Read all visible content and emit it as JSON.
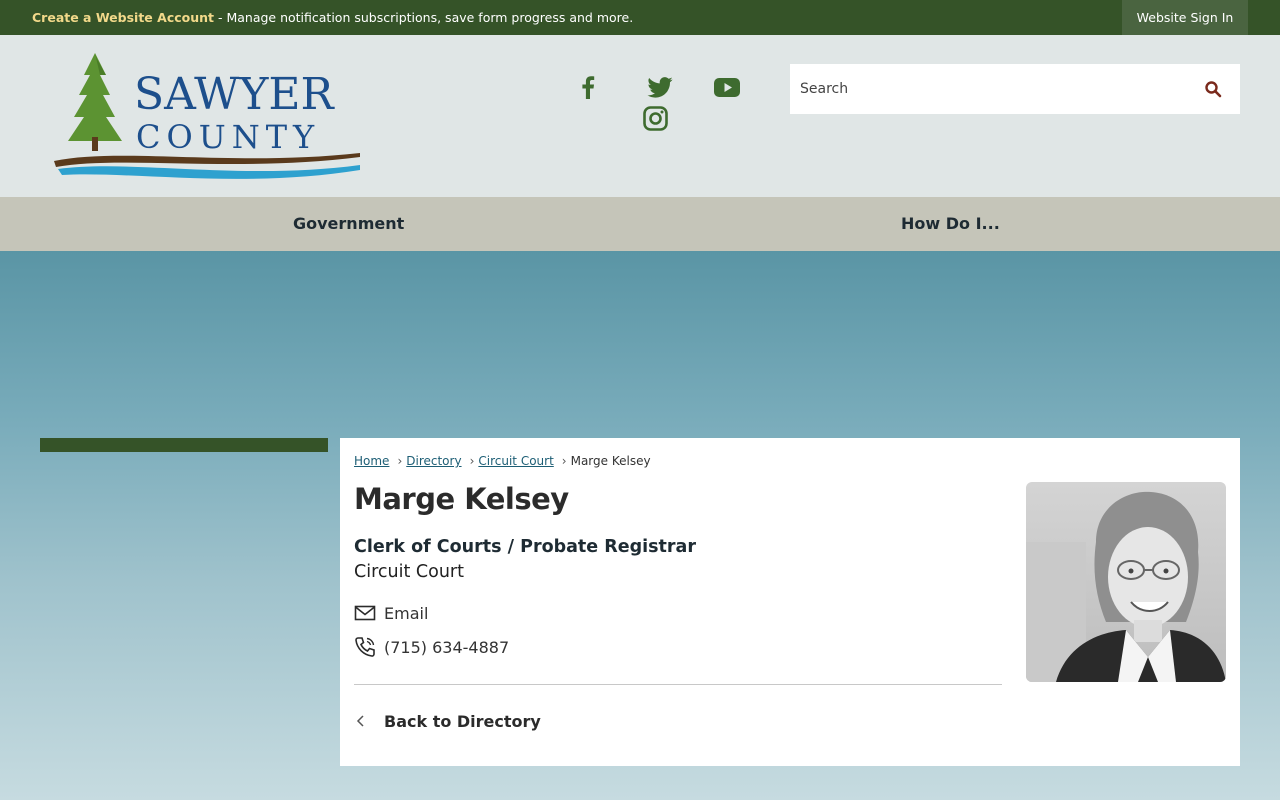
{
  "top_bar": {
    "create_account_link": "Create a Website Account",
    "message": " - Manage notification subscriptions, save form progress and more.",
    "sign_in_label": "Website Sign In",
    "background_color": "#355328",
    "link_color": "#f2d98a"
  },
  "header": {
    "logo": {
      "line1": "SAWYER",
      "line2": "COUNTY",
      "text_color": "#1d4f8c"
    },
    "social_icons": [
      "facebook-icon",
      "twitter-icon",
      "youtube-icon",
      "instagram-icon"
    ],
    "search": {
      "placeholder": "Search",
      "icon": "search-icon"
    }
  },
  "nav": {
    "items": [
      {
        "label": "Government"
      },
      {
        "label": "How Do I..."
      }
    ]
  },
  "breadcrumb": {
    "items": [
      "Home",
      "Directory",
      "Circuit Court"
    ],
    "current": "Marge Kelsey"
  },
  "profile": {
    "name": "Marge Kelsey",
    "title": "Clerk of Courts / Probate Registrar",
    "department": "Circuit Court",
    "email_label": "Email",
    "phone": "(715) 634-4887",
    "back_label": "Back to Directory"
  },
  "colors": {
    "accent_green": "#355328",
    "icon_green": "#3e6b2f",
    "link_blue": "#1d5e75",
    "nav_background": "#c5c5b9"
  }
}
